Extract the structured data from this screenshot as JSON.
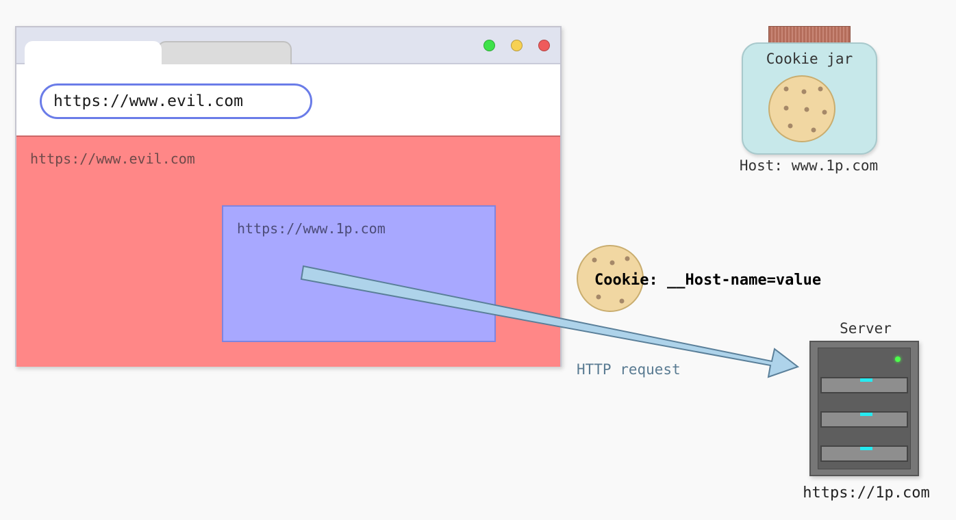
{
  "browser": {
    "address_bar": "https://www.evil.com",
    "outer_frame_origin": "https://www.evil.com",
    "inner_frame_origin": "https://www.1p.com"
  },
  "cookie_jar": {
    "title": "Cookie jar",
    "host_label": "Host: www.1p.com"
  },
  "request": {
    "cookie_header": "Cookie: __Host-name=value",
    "label": "HTTP request"
  },
  "server": {
    "title": "Server",
    "url": "https://1p.com"
  },
  "colors": {
    "evil_frame": "#ff8787",
    "first_party_frame": "#a8a8ff",
    "arrow_fill": "#aed3ea",
    "url_border": "#6a7ce8"
  }
}
